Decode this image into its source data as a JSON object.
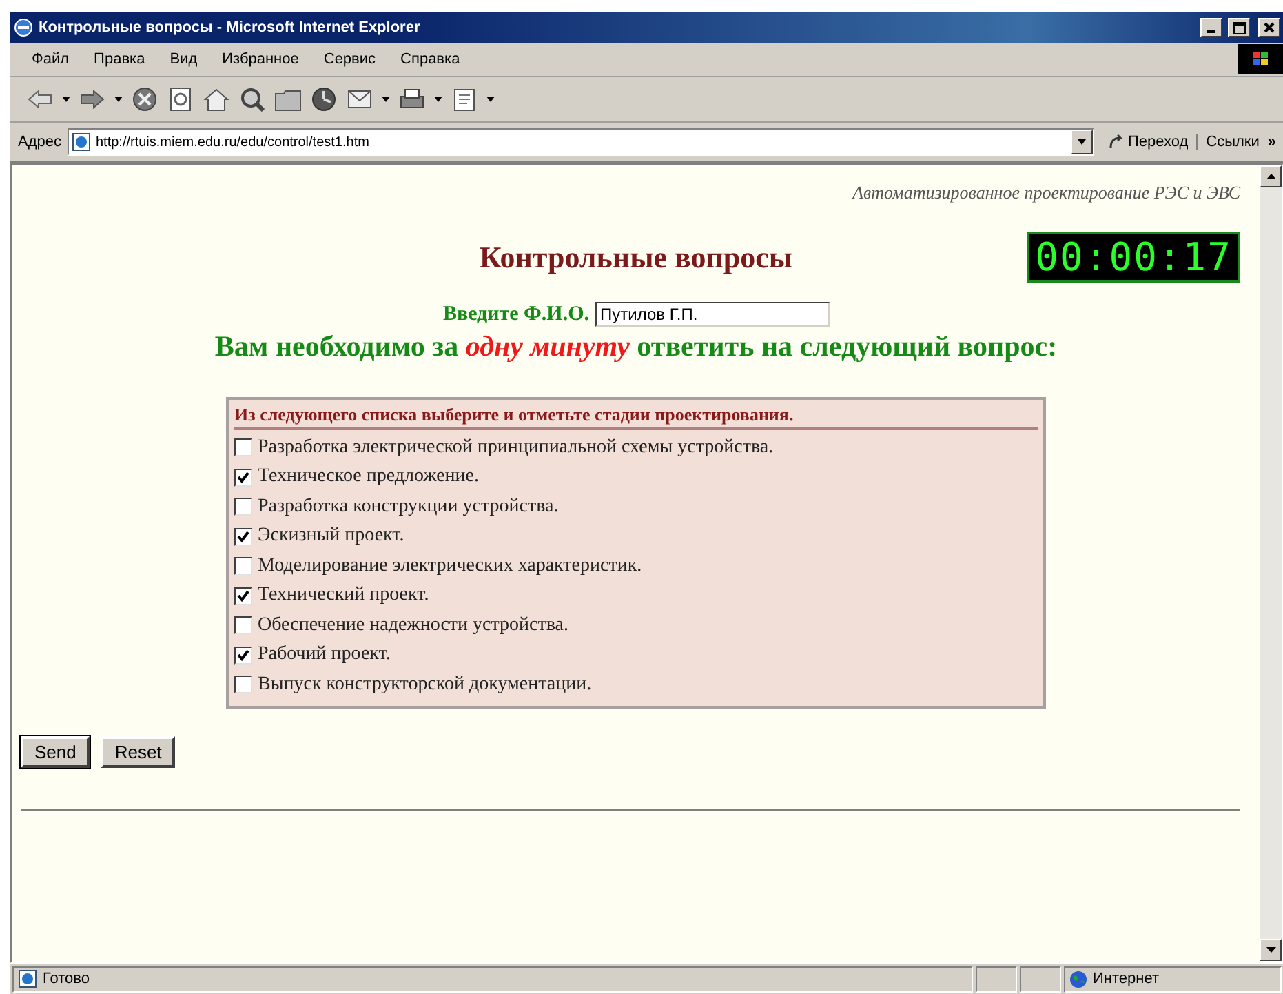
{
  "window": {
    "title": "Контрольные вопросы - Microsoft Internet Explorer"
  },
  "menu": [
    "Файл",
    "Правка",
    "Вид",
    "Избранное",
    "Сервис",
    "Справка"
  ],
  "address": {
    "label": "Адрес",
    "url": "http://rtuis.miem.edu.ru/edu/control/test1.htm",
    "go": "Переход",
    "links": "Ссылки",
    "more": "»"
  },
  "page": {
    "subtitle": "Автоматизированное проектирование РЭС и ЭВС",
    "heading": "Контрольные вопросы",
    "timer": "00:00:17",
    "name_label": "Введите Ф.И.О.",
    "name_value": "Путилов Г.П.",
    "question": "Вам необходимо за *одну минуту* ответить на следующий вопрос:",
    "list_title": "Из следующего списка выберите и отметьте стадии проектирования.",
    "options": [
      {
        "label": "Разработка электрической принципиальной схемы устройства.",
        "checked": false
      },
      {
        "label": "Техническое предложение.",
        "checked": true
      },
      {
        "label": "Разработка конструкции устройства.",
        "checked": false
      },
      {
        "label": "Эскизный проект.",
        "checked": true
      },
      {
        "label": "Моделирование электрических характеристик.",
        "checked": false
      },
      {
        "label": "Технический проект.",
        "checked": true
      },
      {
        "label": "Обеспечение надежности устройства.",
        "checked": false
      },
      {
        "label": "Рабочий проект.",
        "checked": true
      },
      {
        "label": "Выпуск конструкторской документации.",
        "checked": false
      }
    ],
    "buttons": [
      "Send",
      "Reset"
    ]
  },
  "status_bar": {
    "text": "Готово",
    "zone": "Интернет"
  }
}
